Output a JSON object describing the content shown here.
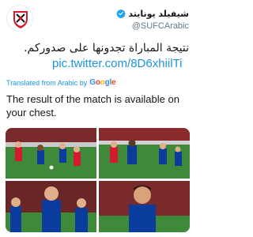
{
  "account": {
    "display_name": "شيفيلد يونايتد",
    "handle": "@SUFCArabic",
    "avatar_icon": "sheffield-united-crest",
    "verified_icon": "verified-badge-icon"
  },
  "tweet": {
    "text_arabic": "نتيجة المباراة تجدونها على صدوركم.",
    "link": "pic.twitter.com/8D6xhiilTi",
    "translated_label": "Translated from Arabic by",
    "translator": "Google",
    "translation": "The result of the match is available on your chest."
  },
  "media": {
    "photos": [
      {
        "name": "photo-1"
      },
      {
        "name": "photo-2"
      },
      {
        "name": "photo-3"
      },
      {
        "name": "photo-4"
      }
    ]
  },
  "colors": {
    "link": "#1b95e0",
    "secondary_text": "#657786",
    "sheffield_red": "#d7192d",
    "chelsea_blue": "#0a3c9e",
    "pitch_green": "#3f8a3a"
  }
}
